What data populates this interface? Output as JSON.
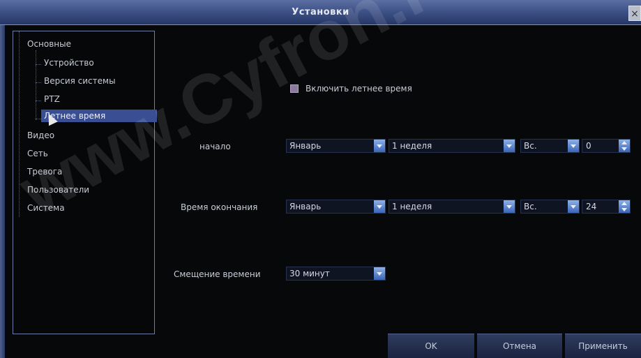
{
  "window": {
    "title": "Установки",
    "close_glyph": "×"
  },
  "tree": {
    "root_label": "Основные",
    "sub_items": [
      "Устройство",
      "Версия системы",
      "PTZ",
      "Летнее время"
    ],
    "top_items": [
      "Видео",
      "Сеть",
      "Тревога",
      "Пользователи",
      "Система"
    ]
  },
  "dst": {
    "enable_label": "Включить летнее время",
    "start_label": "начало",
    "start_month": "Январь",
    "start_week": "1 неделя",
    "start_day": "Вс.",
    "start_hour": "0",
    "end_label": "Время окончания",
    "end_month": "Январь",
    "end_week": "1 неделя",
    "end_day": "Вс.",
    "end_hour": "24",
    "offset_label": "Смещение времени",
    "offset_value": "30 минут"
  },
  "buttons": {
    "ok": "OK",
    "cancel": "Отмена",
    "apply": "Применить"
  },
  "watermark": "www.Cyfron.ru",
  "colors": {
    "title_bar": "#3f5388",
    "selection": "#3a4e94",
    "dropdown_arrow": "#3a66b8"
  }
}
